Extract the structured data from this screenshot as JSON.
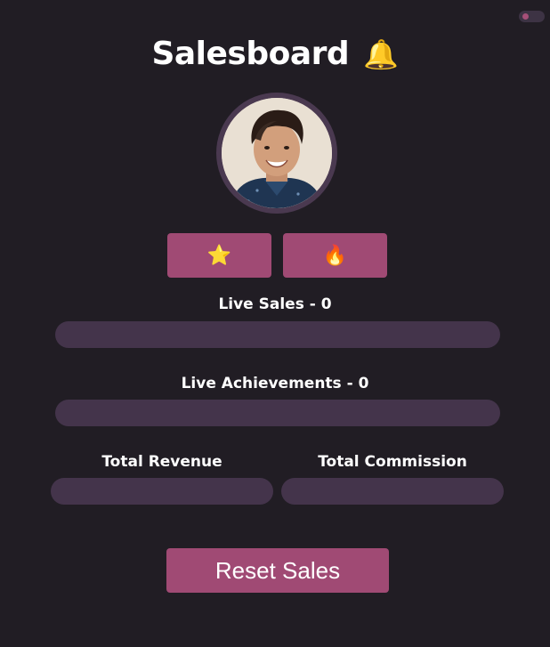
{
  "header": {
    "title": "Salesboard",
    "title_icon": "bell-icon",
    "bell_glyph": "🔔"
  },
  "theme_toggle": {
    "accent": "#a64f78",
    "track": "#3d3344"
  },
  "reactions": {
    "star": {
      "icon": "star-icon",
      "glyph": "⭐"
    },
    "fire": {
      "icon": "fire-icon",
      "glyph": "🔥"
    }
  },
  "live_sales": {
    "label": "Live Sales - 0",
    "progress": 0
  },
  "live_achievements": {
    "label": "Live Achievements - 0",
    "progress": 0
  },
  "totals": {
    "revenue_label": "Total Revenue",
    "revenue_value": "",
    "commission_label": "Total Commission",
    "commission_value": ""
  },
  "actions": {
    "reset_label": "Reset Sales"
  },
  "colors": {
    "background": "#211d24",
    "accent": "#a04a74",
    "track": "#44344b",
    "avatar_ring": "#4a3950"
  }
}
